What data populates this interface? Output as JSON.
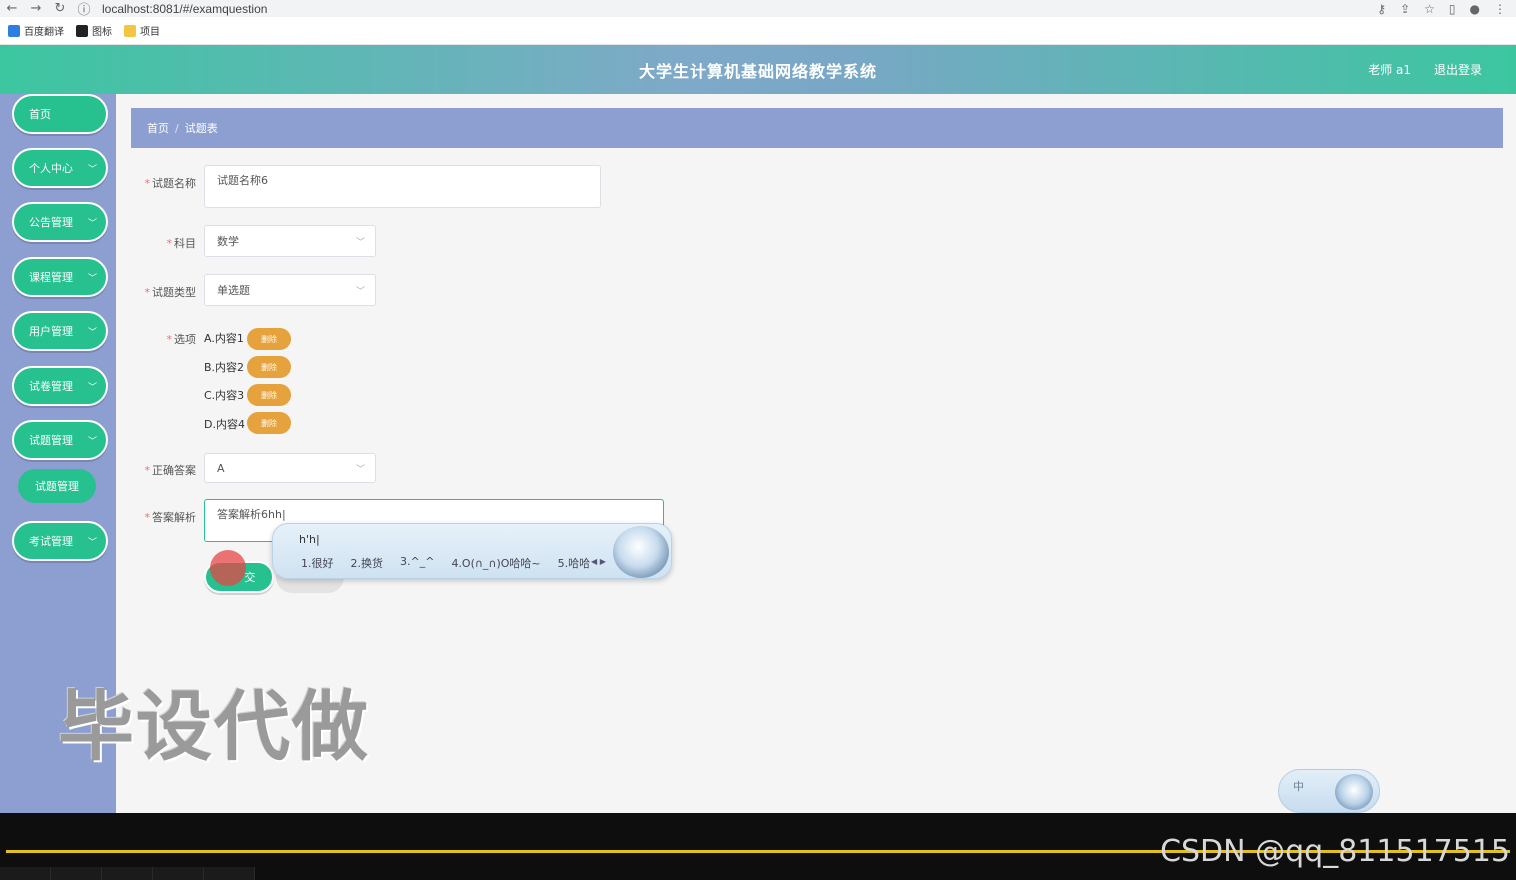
{
  "browser": {
    "url": "localhost:8081/#/examquestion",
    "bookmarks": [
      "百度翻译",
      "图标",
      "项目"
    ]
  },
  "header": {
    "title": "大学生计算机基础网络教学系统",
    "user": "老师 a1",
    "logout": "退出登录"
  },
  "sidebar": {
    "items": [
      {
        "label": "首页"
      },
      {
        "label": "个人中心"
      },
      {
        "label": "公告管理"
      },
      {
        "label": "课程管理"
      },
      {
        "label": "用户管理"
      },
      {
        "label": "试卷管理"
      },
      {
        "label": "试题管理"
      },
      {
        "label": "考试管理"
      }
    ],
    "sub_item": "试题管理"
  },
  "breadcrumb": {
    "home": "首页",
    "sep": "/",
    "current": "试题表"
  },
  "form": {
    "name_label": "试题名称",
    "name_value": "试题名称6",
    "subject_label": "科目",
    "subject_value": "数学",
    "type_label": "试题类型",
    "type_value": "单选题",
    "options_label": "选项",
    "options": [
      "A.内容1",
      "B.内容2",
      "C.内容3",
      "D.内容4"
    ],
    "delete_label": "删除",
    "answer_label": "正确答案",
    "answer_value": "A",
    "analysis_label": "答案解析",
    "analysis_value": "答案解析6hh|",
    "submit_label": "交"
  },
  "ime": {
    "composition": "h'h|",
    "candidates": [
      "1.很好",
      "2.换货",
      "3.^_^",
      "4.O(∩_∩)O哈哈~",
      "5.哈哈"
    ],
    "status": "中"
  },
  "watermark": "毕设代做",
  "player": {
    "credit": "CSDN @qq_811517515"
  },
  "colors": {
    "accent_green": "#27c08f",
    "sidebar_blue": "#8d9fd0",
    "delete_orange": "#e6a23c"
  }
}
